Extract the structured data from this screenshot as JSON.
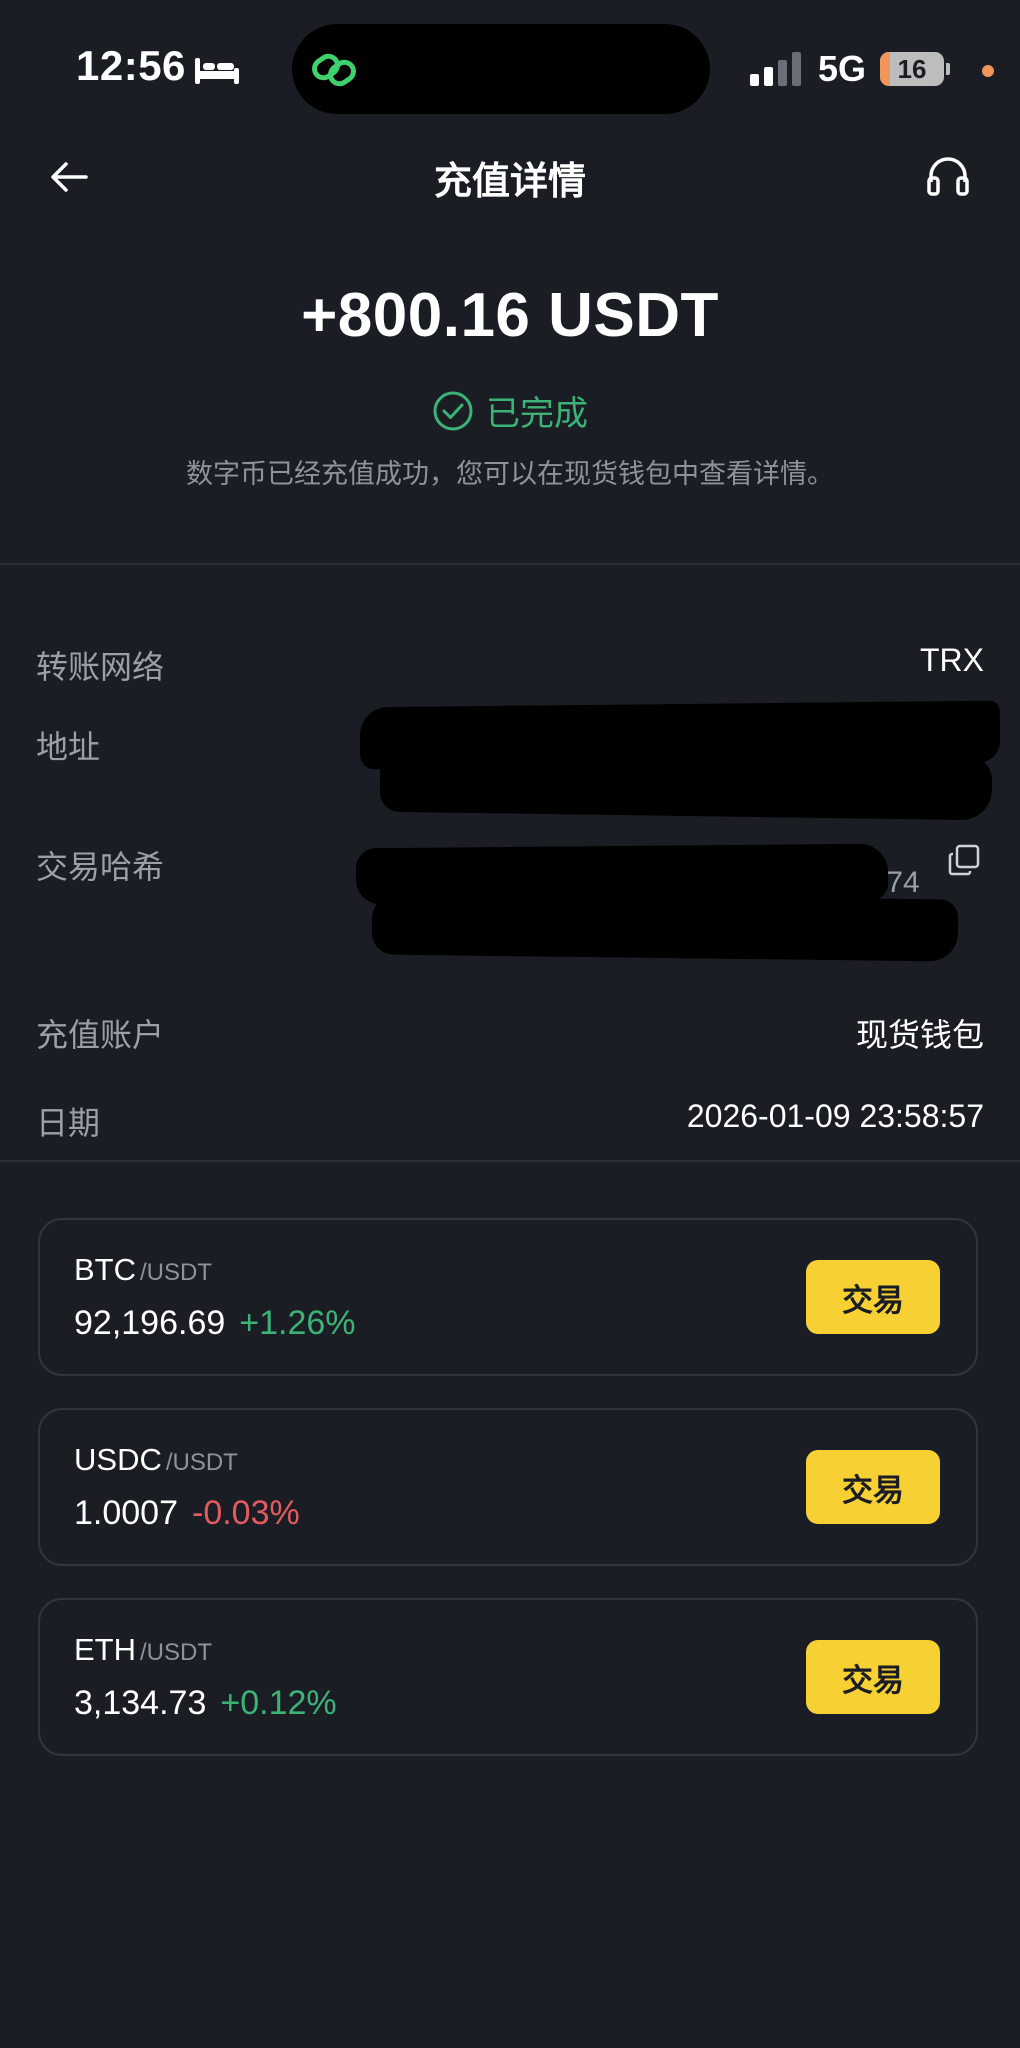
{
  "status_bar": {
    "time": "12:56",
    "network": "5G",
    "battery": "16",
    "battery_level": 0.16
  },
  "header": {
    "title": "充值详情"
  },
  "deposit": {
    "amount": "+800.16 USDT",
    "status": "已完成",
    "note": "数字币已经充值成功，您可以在现货钱包中查看详情。"
  },
  "details": {
    "network_label": "转账网络",
    "network_value": "TRX",
    "address_label": "地址",
    "hash_label": "交易哈希",
    "hash_fragment": "/74",
    "account_label": "充值账户",
    "account_value": "现货钱包",
    "date_label": "日期",
    "date_value": "2026-01-09 23:58:57"
  },
  "markets": [
    {
      "base": "BTC",
      "quote": "/USDT",
      "price": "92,196.69",
      "change": "+1.26%",
      "trade_label": "交易"
    },
    {
      "base": "USDC",
      "quote": "/USDT",
      "price": "1.0007",
      "change": "-0.03%",
      "trade_label": "交易"
    },
    {
      "base": "ETH",
      "quote": "/USDT",
      "price": "3,134.73",
      "change": "+0.12%",
      "trade_label": "交易"
    }
  ],
  "colors": {
    "background": "#1b1d25",
    "success": "#3bb377",
    "negative": "#e35a5f",
    "accent": "#f7d133",
    "battery": "#f0955c"
  }
}
